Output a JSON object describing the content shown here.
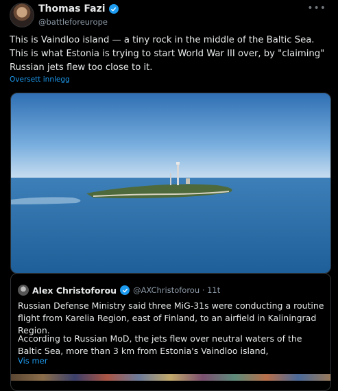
{
  "post": {
    "author_name": "Thomas Fazi",
    "author_handle": "@battleforeurope",
    "more_icon": "•••",
    "text": "This is Vaindloo island — a tiny rock in the middle of the Baltic Sea. This is what Estonia is trying to start World War III over, by \"claiming\" Russian jets flew too close to it.",
    "translate_label": "Oversett innlegg"
  },
  "quote": {
    "author_name": "Alex Christoforou",
    "author_handle": "@AXChristoforou · 11t",
    "text_1": "Russian Defense Ministry said three MiG-31s were conducting a routine flight from Karelia Region, east of Finland, to an airfield in Kaliningrad Region.",
    "text_2": "According to Russian MoD, the jets flew over neutral waters of the Baltic Sea, more than 3 km from Estonia's Vaindloo island,",
    "more_label": "Vis mer"
  },
  "colors": {
    "background": "#000000",
    "text": "#e7e9ea",
    "secondary_text": "#8b98a5",
    "accent_blue": "#1d9bf0",
    "border": "#2f3336"
  },
  "icons": {
    "verified": "verified-badge-icon",
    "more": "more-dots-icon"
  }
}
